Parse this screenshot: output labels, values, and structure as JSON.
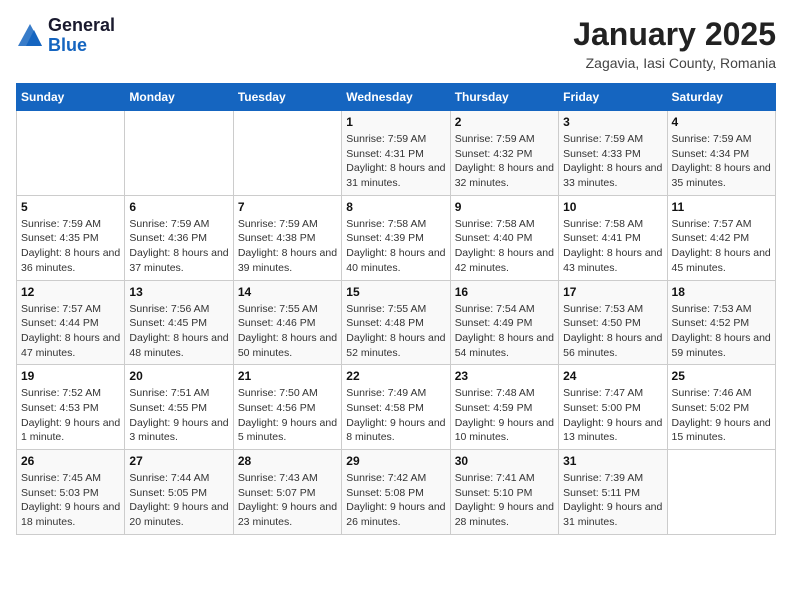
{
  "header": {
    "logo_general": "General",
    "logo_blue": "Blue",
    "month_title": "January 2025",
    "location": "Zagavia, Iasi County, Romania"
  },
  "days_of_week": [
    "Sunday",
    "Monday",
    "Tuesday",
    "Wednesday",
    "Thursday",
    "Friday",
    "Saturday"
  ],
  "weeks": [
    [
      {
        "day": "",
        "sunrise": "",
        "sunset": "",
        "daylight": ""
      },
      {
        "day": "",
        "sunrise": "",
        "sunset": "",
        "daylight": ""
      },
      {
        "day": "",
        "sunrise": "",
        "sunset": "",
        "daylight": ""
      },
      {
        "day": "1",
        "sunrise": "Sunrise: 7:59 AM",
        "sunset": "Sunset: 4:31 PM",
        "daylight": "Daylight: 8 hours and 31 minutes."
      },
      {
        "day": "2",
        "sunrise": "Sunrise: 7:59 AM",
        "sunset": "Sunset: 4:32 PM",
        "daylight": "Daylight: 8 hours and 32 minutes."
      },
      {
        "day": "3",
        "sunrise": "Sunrise: 7:59 AM",
        "sunset": "Sunset: 4:33 PM",
        "daylight": "Daylight: 8 hours and 33 minutes."
      },
      {
        "day": "4",
        "sunrise": "Sunrise: 7:59 AM",
        "sunset": "Sunset: 4:34 PM",
        "daylight": "Daylight: 8 hours and 35 minutes."
      }
    ],
    [
      {
        "day": "5",
        "sunrise": "Sunrise: 7:59 AM",
        "sunset": "Sunset: 4:35 PM",
        "daylight": "Daylight: 8 hours and 36 minutes."
      },
      {
        "day": "6",
        "sunrise": "Sunrise: 7:59 AM",
        "sunset": "Sunset: 4:36 PM",
        "daylight": "Daylight: 8 hours and 37 minutes."
      },
      {
        "day": "7",
        "sunrise": "Sunrise: 7:59 AM",
        "sunset": "Sunset: 4:38 PM",
        "daylight": "Daylight: 8 hours and 39 minutes."
      },
      {
        "day": "8",
        "sunrise": "Sunrise: 7:58 AM",
        "sunset": "Sunset: 4:39 PM",
        "daylight": "Daylight: 8 hours and 40 minutes."
      },
      {
        "day": "9",
        "sunrise": "Sunrise: 7:58 AM",
        "sunset": "Sunset: 4:40 PM",
        "daylight": "Daylight: 8 hours and 42 minutes."
      },
      {
        "day": "10",
        "sunrise": "Sunrise: 7:58 AM",
        "sunset": "Sunset: 4:41 PM",
        "daylight": "Daylight: 8 hours and 43 minutes."
      },
      {
        "day": "11",
        "sunrise": "Sunrise: 7:57 AM",
        "sunset": "Sunset: 4:42 PM",
        "daylight": "Daylight: 8 hours and 45 minutes."
      }
    ],
    [
      {
        "day": "12",
        "sunrise": "Sunrise: 7:57 AM",
        "sunset": "Sunset: 4:44 PM",
        "daylight": "Daylight: 8 hours and 47 minutes."
      },
      {
        "day": "13",
        "sunrise": "Sunrise: 7:56 AM",
        "sunset": "Sunset: 4:45 PM",
        "daylight": "Daylight: 8 hours and 48 minutes."
      },
      {
        "day": "14",
        "sunrise": "Sunrise: 7:55 AM",
        "sunset": "Sunset: 4:46 PM",
        "daylight": "Daylight: 8 hours and 50 minutes."
      },
      {
        "day": "15",
        "sunrise": "Sunrise: 7:55 AM",
        "sunset": "Sunset: 4:48 PM",
        "daylight": "Daylight: 8 hours and 52 minutes."
      },
      {
        "day": "16",
        "sunrise": "Sunrise: 7:54 AM",
        "sunset": "Sunset: 4:49 PM",
        "daylight": "Daylight: 8 hours and 54 minutes."
      },
      {
        "day": "17",
        "sunrise": "Sunrise: 7:53 AM",
        "sunset": "Sunset: 4:50 PM",
        "daylight": "Daylight: 8 hours and 56 minutes."
      },
      {
        "day": "18",
        "sunrise": "Sunrise: 7:53 AM",
        "sunset": "Sunset: 4:52 PM",
        "daylight": "Daylight: 8 hours and 59 minutes."
      }
    ],
    [
      {
        "day": "19",
        "sunrise": "Sunrise: 7:52 AM",
        "sunset": "Sunset: 4:53 PM",
        "daylight": "Daylight: 9 hours and 1 minute."
      },
      {
        "day": "20",
        "sunrise": "Sunrise: 7:51 AM",
        "sunset": "Sunset: 4:55 PM",
        "daylight": "Daylight: 9 hours and 3 minutes."
      },
      {
        "day": "21",
        "sunrise": "Sunrise: 7:50 AM",
        "sunset": "Sunset: 4:56 PM",
        "daylight": "Daylight: 9 hours and 5 minutes."
      },
      {
        "day": "22",
        "sunrise": "Sunrise: 7:49 AM",
        "sunset": "Sunset: 4:58 PM",
        "daylight": "Daylight: 9 hours and 8 minutes."
      },
      {
        "day": "23",
        "sunrise": "Sunrise: 7:48 AM",
        "sunset": "Sunset: 4:59 PM",
        "daylight": "Daylight: 9 hours and 10 minutes."
      },
      {
        "day": "24",
        "sunrise": "Sunrise: 7:47 AM",
        "sunset": "Sunset: 5:00 PM",
        "daylight": "Daylight: 9 hours and 13 minutes."
      },
      {
        "day": "25",
        "sunrise": "Sunrise: 7:46 AM",
        "sunset": "Sunset: 5:02 PM",
        "daylight": "Daylight: 9 hours and 15 minutes."
      }
    ],
    [
      {
        "day": "26",
        "sunrise": "Sunrise: 7:45 AM",
        "sunset": "Sunset: 5:03 PM",
        "daylight": "Daylight: 9 hours and 18 minutes."
      },
      {
        "day": "27",
        "sunrise": "Sunrise: 7:44 AM",
        "sunset": "Sunset: 5:05 PM",
        "daylight": "Daylight: 9 hours and 20 minutes."
      },
      {
        "day": "28",
        "sunrise": "Sunrise: 7:43 AM",
        "sunset": "Sunset: 5:07 PM",
        "daylight": "Daylight: 9 hours and 23 minutes."
      },
      {
        "day": "29",
        "sunrise": "Sunrise: 7:42 AM",
        "sunset": "Sunset: 5:08 PM",
        "daylight": "Daylight: 9 hours and 26 minutes."
      },
      {
        "day": "30",
        "sunrise": "Sunrise: 7:41 AM",
        "sunset": "Sunset: 5:10 PM",
        "daylight": "Daylight: 9 hours and 28 minutes."
      },
      {
        "day": "31",
        "sunrise": "Sunrise: 7:39 AM",
        "sunset": "Sunset: 5:11 PM",
        "daylight": "Daylight: 9 hours and 31 minutes."
      },
      {
        "day": "",
        "sunrise": "",
        "sunset": "",
        "daylight": ""
      }
    ]
  ]
}
